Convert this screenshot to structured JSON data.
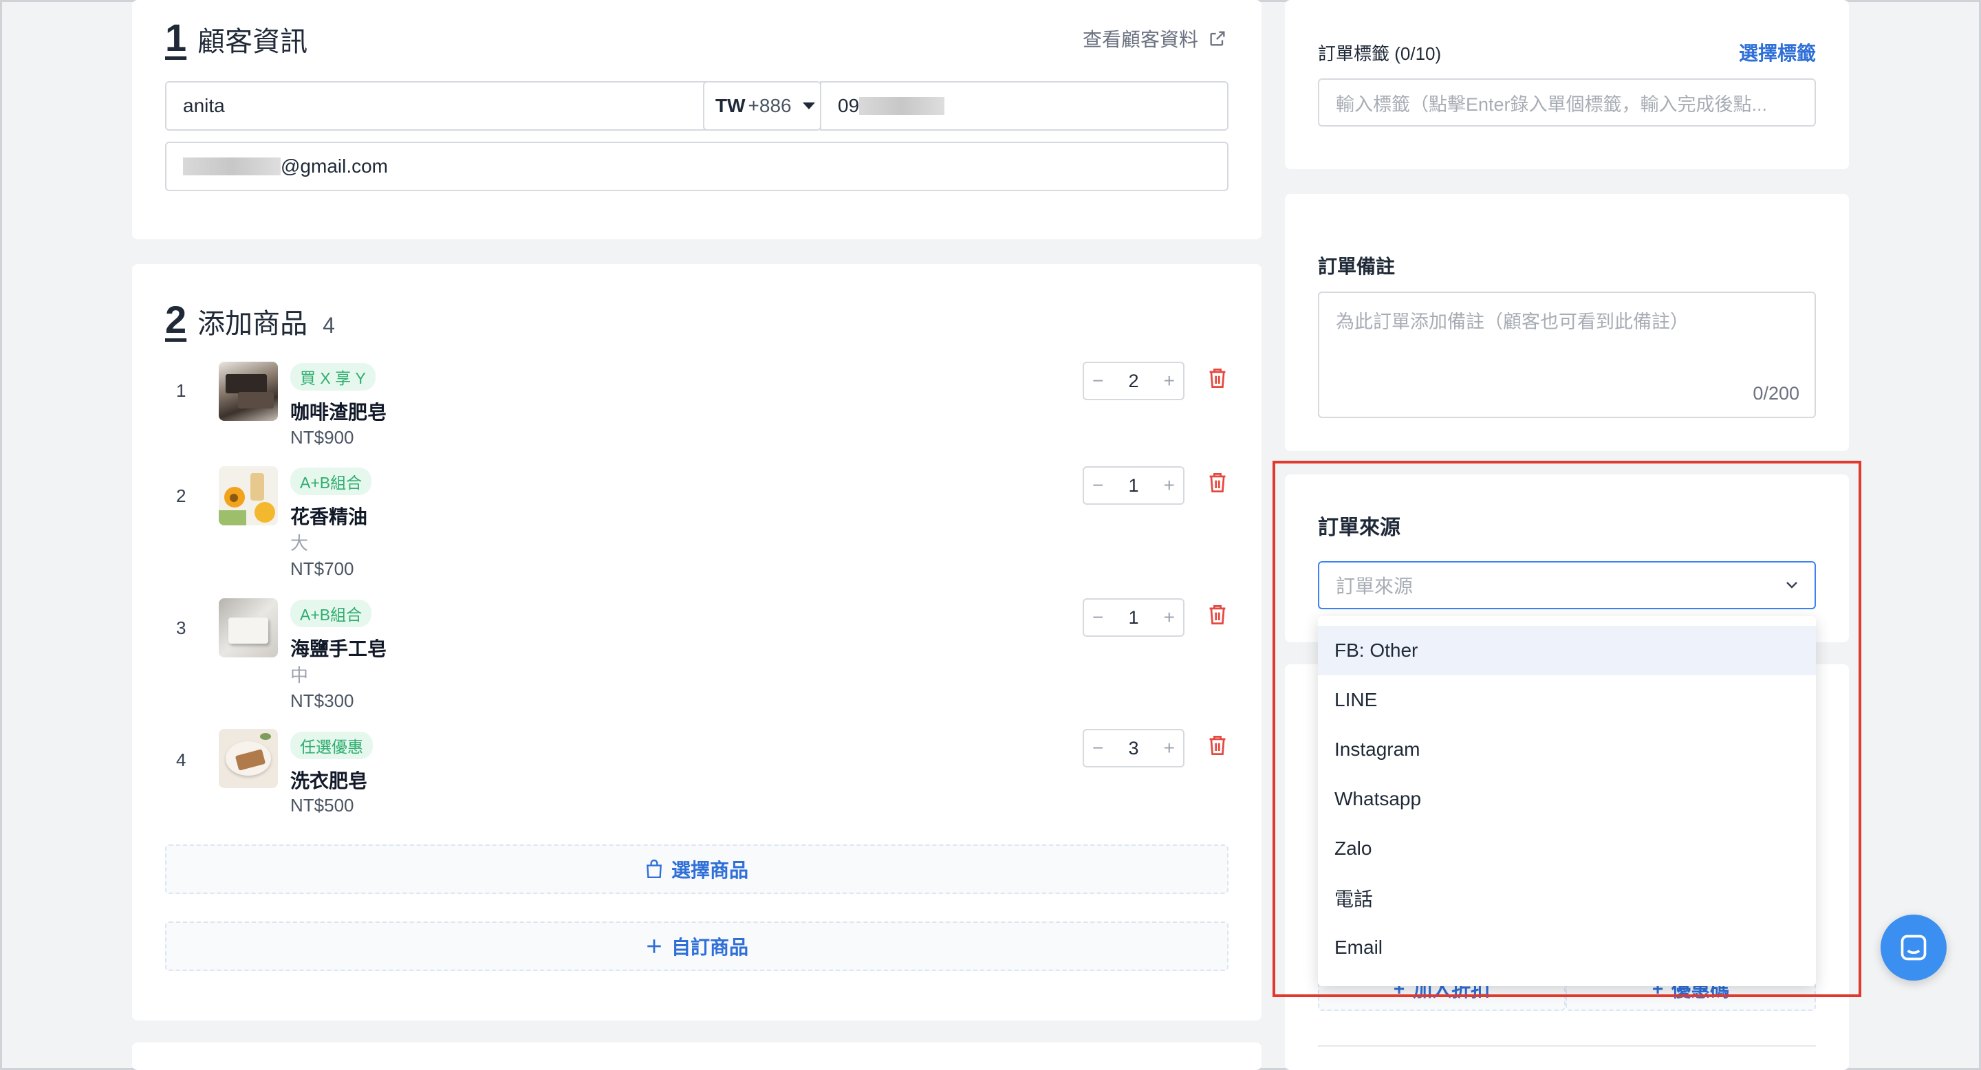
{
  "customer": {
    "section_number": "1",
    "title": "顧客資訊",
    "view_link": "查看顧客資料",
    "name_value": "anita",
    "country_code": "TW",
    "dial_code": "+886",
    "phone_prefix": "09",
    "email_suffix": "@gmail.com"
  },
  "products": {
    "section_number": "2",
    "title": "添加商品",
    "count": "4",
    "items": [
      {
        "index": "1",
        "tag": "買 X 享 Y",
        "name": "咖啡渣肥皂",
        "variant": "",
        "price": "NT$900",
        "qty": "2"
      },
      {
        "index": "2",
        "tag": "A+B組合",
        "name": "花香精油",
        "variant": "大",
        "price": "NT$700",
        "qty": "1"
      },
      {
        "index": "3",
        "tag": "A+B組合",
        "name": "海鹽手工皂",
        "variant": "中",
        "price": "NT$300",
        "qty": "1"
      },
      {
        "index": "4",
        "tag": "任選優惠",
        "name": "洗衣肥皂",
        "variant": "",
        "price": "NT$500",
        "qty": "3"
      }
    ],
    "select_button": "選擇商品",
    "custom_button": "自訂商品"
  },
  "tags": {
    "label": "訂單標籤 (0/10)",
    "select_link": "選擇標籤",
    "placeholder": "輸入標籤（點擊Enter錄入單個標籤，輸入完成後點..."
  },
  "notes": {
    "label": "訂單備註",
    "placeholder": "為此訂單添加備註（顧客也可看到此備註）",
    "counter": "0/200"
  },
  "source": {
    "label": "訂單來源",
    "placeholder": "訂單來源",
    "options": [
      "FB: Other",
      "LINE",
      "Instagram",
      "Whatsapp",
      "Zalo",
      "電話",
      "Email"
    ],
    "highlighted_option": "FB: Other"
  },
  "discount": {
    "add_discount": "加入折扣",
    "coupon": "優惠碼"
  },
  "colors": {
    "accent": "#2e6fd8",
    "highlight_box": "#e2392f",
    "tag_green": "#2fae6f",
    "delete_red": "#e5483f"
  }
}
